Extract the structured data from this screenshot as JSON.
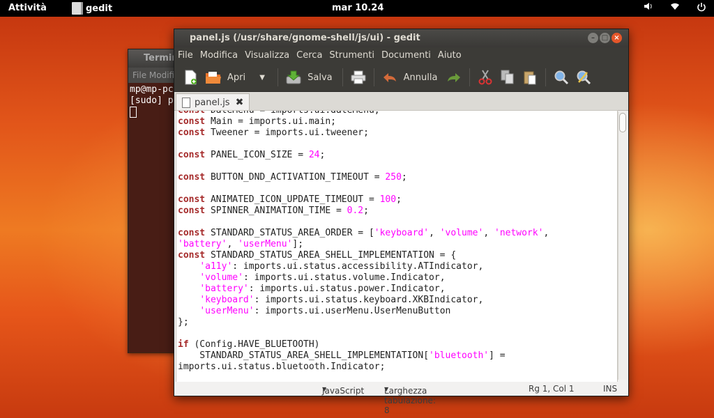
{
  "topbar": {
    "activities": "Attività",
    "app_name": "gedit",
    "clock": "mar 10.24",
    "tray_icons": [
      "volume-icon",
      "wifi-icon",
      "power-icon"
    ]
  },
  "terminal": {
    "title": "Terminale",
    "menu": "File Modifica",
    "lines": [
      "mp@mp-pc",
      "[sudo] p"
    ]
  },
  "gedit": {
    "title": "panel.js (/usr/share/gnome-shell/js/ui) - gedit",
    "menu": [
      "File",
      "Modifica",
      "Visualizza",
      "Cerca",
      "Strumenti",
      "Documenti",
      "Aiuto"
    ],
    "toolbar": {
      "open_label": "Apri",
      "save_label": "Salva",
      "undo_label": "Annulla"
    },
    "tab_label": "panel.js",
    "code": [
      [
        [
          "kw",
          "const"
        ],
        [
          "t",
          " DateMenu = imports.ui.dateMenu;"
        ]
      ],
      [
        [
          "kw",
          "const"
        ],
        [
          "t",
          " Main = imports.ui.main;"
        ]
      ],
      [
        [
          "kw",
          "const"
        ],
        [
          "t",
          " Tweener = imports.ui.tweener;"
        ]
      ],
      [],
      [
        [
          "kw",
          "const"
        ],
        [
          "t",
          " PANEL_ICON_SIZE = "
        ],
        [
          "num",
          "24"
        ],
        [
          "t",
          ";"
        ]
      ],
      [],
      [
        [
          "kw",
          "const"
        ],
        [
          "t",
          " BUTTON_DND_ACTIVATION_TIMEOUT = "
        ],
        [
          "num",
          "250"
        ],
        [
          "t",
          ";"
        ]
      ],
      [],
      [
        [
          "kw",
          "const"
        ],
        [
          "t",
          " ANIMATED_ICON_UPDATE_TIMEOUT = "
        ],
        [
          "num",
          "100"
        ],
        [
          "t",
          ";"
        ]
      ],
      [
        [
          "kw",
          "const"
        ],
        [
          "t",
          " SPINNER_ANIMATION_TIME = "
        ],
        [
          "num",
          "0.2"
        ],
        [
          "t",
          ";"
        ]
      ],
      [],
      [
        [
          "kw",
          "const"
        ],
        [
          "t",
          " STANDARD_STATUS_AREA_ORDER = ["
        ],
        [
          "str",
          "'keyboard'"
        ],
        [
          "t",
          ", "
        ],
        [
          "str",
          "'volume'"
        ],
        [
          "t",
          ", "
        ],
        [
          "str",
          "'network'"
        ],
        [
          "t",
          ","
        ]
      ],
      [
        [
          "str",
          "'battery'"
        ],
        [
          "t",
          ", "
        ],
        [
          "str",
          "'userMenu'"
        ],
        [
          "t",
          "];"
        ]
      ],
      [
        [
          "kw",
          "const"
        ],
        [
          "t",
          " STANDARD_STATUS_AREA_SHELL_IMPLEMENTATION = {"
        ]
      ],
      [
        [
          "t",
          "    "
        ],
        [
          "str",
          "'a11y'"
        ],
        [
          "t",
          ": imports.ui.status.accessibility.ATIndicator,"
        ]
      ],
      [
        [
          "t",
          "    "
        ],
        [
          "str",
          "'volume'"
        ],
        [
          "t",
          ": imports.ui.status.volume.Indicator,"
        ]
      ],
      [
        [
          "t",
          "    "
        ],
        [
          "str",
          "'battery'"
        ],
        [
          "t",
          ": imports.ui.status.power.Indicator,"
        ]
      ],
      [
        [
          "t",
          "    "
        ],
        [
          "str",
          "'keyboard'"
        ],
        [
          "t",
          ": imports.ui.status.keyboard.XKBIndicator,"
        ]
      ],
      [
        [
          "t",
          "    "
        ],
        [
          "str",
          "'userMenu'"
        ],
        [
          "t",
          ": imports.ui.userMenu.UserMenuButton"
        ]
      ],
      [
        [
          "t",
          "};"
        ]
      ],
      [],
      [
        [
          "kw",
          "if"
        ],
        [
          "t",
          " (Config.HAVE_BLUETOOTH)"
        ]
      ],
      [
        [
          "t",
          "    STANDARD_STATUS_AREA_SHELL_IMPLEMENTATION["
        ],
        [
          "str",
          "'bluetooth'"
        ],
        [
          "t",
          "] ="
        ]
      ],
      [
        [
          "t",
          "imports.ui.status.bluetooth.Indicator;"
        ]
      ]
    ],
    "status": {
      "language": "JavaScript",
      "tab_width": "Larghezza tabulazione:  8",
      "position": "Rg 1, Col 1",
      "mode": "INS"
    }
  }
}
